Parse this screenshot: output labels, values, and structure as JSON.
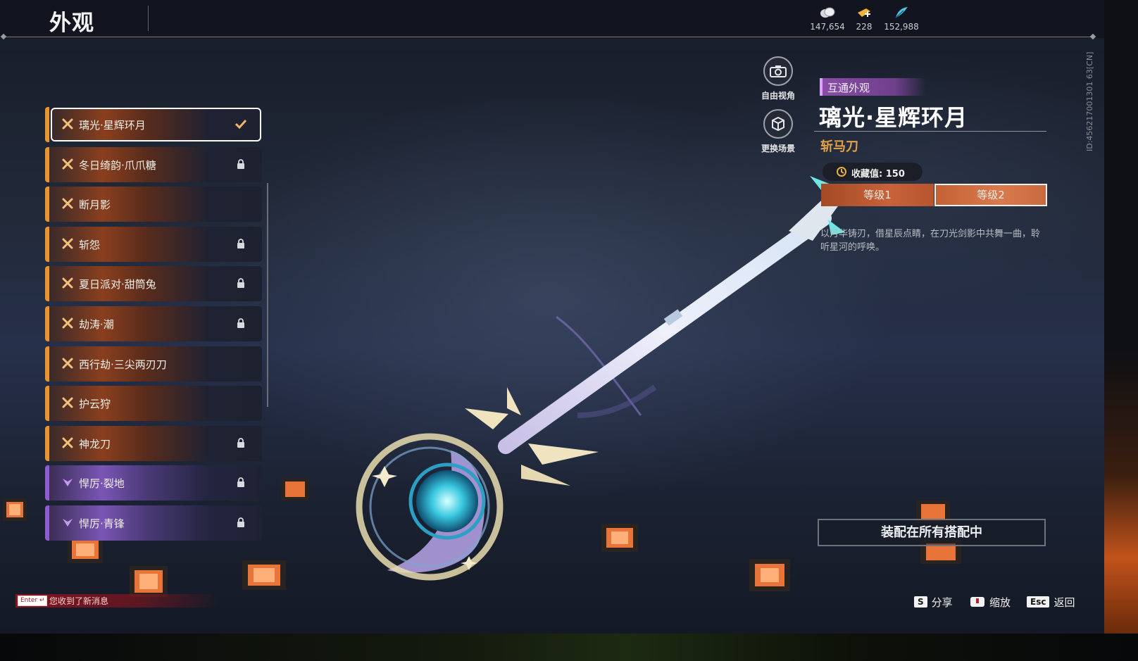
{
  "header": {
    "title": "外观",
    "currencies": [
      {
        "icon": "coin-stack-icon",
        "value": "147,654"
      },
      {
        "icon": "ticket-icon",
        "value": "228"
      },
      {
        "icon": "feather-icon",
        "value": "152,988"
      }
    ]
  },
  "build_id": "ID:456217001301 63[CN]",
  "skin_list": [
    {
      "name": "璃光·星辉环月",
      "tier": "orange",
      "status": "equipped"
    },
    {
      "name": "冬日绮韵·爪爪糖",
      "tier": "orange",
      "status": "locked"
    },
    {
      "name": "断月影",
      "tier": "orange",
      "status": "none"
    },
    {
      "name": "斩怨",
      "tier": "orange",
      "status": "locked"
    },
    {
      "name": "夏日派对·甜筒兔",
      "tier": "orange",
      "status": "locked"
    },
    {
      "name": "劫涛·潮",
      "tier": "orange",
      "status": "locked"
    },
    {
      "name": "西行劫·三尖两刃刀",
      "tier": "orange",
      "status": "none"
    },
    {
      "name": "护云狩",
      "tier": "orange",
      "status": "none"
    },
    {
      "name": "神龙刀",
      "tier": "orange",
      "status": "locked"
    },
    {
      "name": "悍厉·裂地",
      "tier": "purple",
      "status": "locked"
    },
    {
      "name": "悍厉·青锋",
      "tier": "purple",
      "status": "locked"
    }
  ],
  "camera": {
    "free_view_label": "自由视角",
    "change_scene_label": "更换场景"
  },
  "detail": {
    "tag": "互通外观",
    "title": "璃光·星辉环月",
    "weapon_type": "斩马刀",
    "collection_label": "收藏值: 150",
    "levels": [
      "等级1",
      "等级2"
    ],
    "selected_level": 2,
    "description": "以月华铸刃，借星辰点睛，在刀光剑影中共舞一曲，聆听星河的呼唤。",
    "equip_all_label": "装配在所有搭配中"
  },
  "footer": {
    "share_key": "S",
    "share_label": "分享",
    "zoom_label": "缩放",
    "back_key": "Esc",
    "back_label": "返回"
  },
  "notification": {
    "key": "Enter",
    "text": "您收到了新消息"
  },
  "colors": {
    "orange_tier": "#e8952f",
    "purple_tier": "#8f5ccf",
    "accent_text": "#e3a24a",
    "level_tab": "#c8623a"
  }
}
